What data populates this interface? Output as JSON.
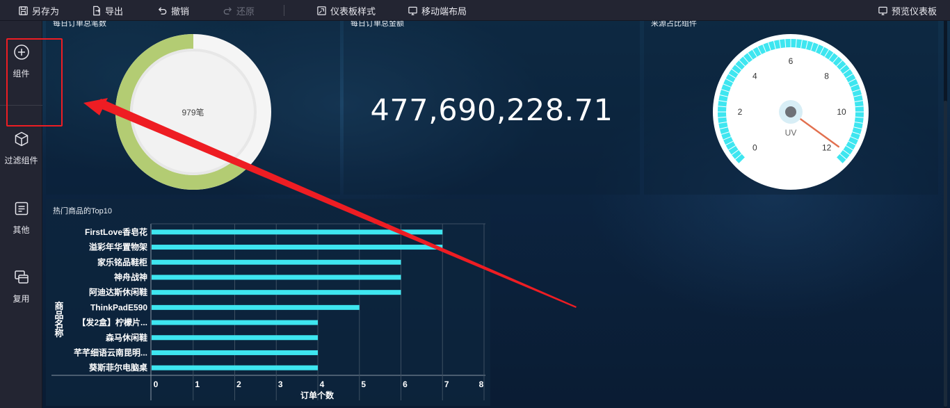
{
  "toolbar": {
    "save_as": "另存为",
    "export": "导出",
    "undo": "撤销",
    "redo": "还原",
    "dashboard_style": "仪表板样式",
    "mobile_layout": "移动端布局",
    "preview": "预览仪表板"
  },
  "sidebar": {
    "items": [
      {
        "label": "组件",
        "icon": "plus-circle-icon"
      },
      {
        "label": "过滤组件",
        "icon": "cube-icon"
      },
      {
        "label": "其他",
        "icon": "document-icon"
      },
      {
        "label": "复用",
        "icon": "copy-icon"
      }
    ]
  },
  "colors": {
    "annotation": "#ee1d23",
    "accent_cyan": "#3ee6f0",
    "ring_green": "#b3cc73",
    "needle": "#e2704f"
  },
  "widgets": {
    "orders": {
      "title": "每日订单总笔数",
      "center_value": "979笔",
      "fill_fraction": 0.62
    },
    "amount": {
      "title": "每日订单总金额",
      "value": "477,690,228.71"
    },
    "gauge": {
      "title": "来源占比组件",
      "center_label": "UV",
      "ticks": [
        "0",
        "2",
        "4",
        "6",
        "8",
        "10",
        "12"
      ],
      "min": 0,
      "max": 12,
      "value": 11.6
    }
  },
  "chart_data": {
    "type": "bar",
    "orientation": "horizontal",
    "title": "热门商品的Top10",
    "xlabel": "订单个数",
    "ylabel": "商品名称",
    "categories": [
      "FirstLove香皂花",
      "溢彩年华置物架",
      "家乐铭品鞋柜",
      "神舟战神",
      "阿迪达斯休闲鞋",
      "ThinkPadE590",
      "【发2盒】柠檬片...",
      "森马休闲鞋",
      "芊芊细语云南昆明...",
      "葵斯菲尔电脑桌"
    ],
    "values": [
      7,
      7,
      6,
      6,
      6,
      5,
      4,
      4,
      4,
      4
    ],
    "xlim": [
      0,
      8
    ],
    "xticks": [
      "0",
      "1",
      "2",
      "3",
      "4",
      "5",
      "6",
      "7",
      "8"
    ],
    "grid": true,
    "color": "#3ee6f0"
  }
}
